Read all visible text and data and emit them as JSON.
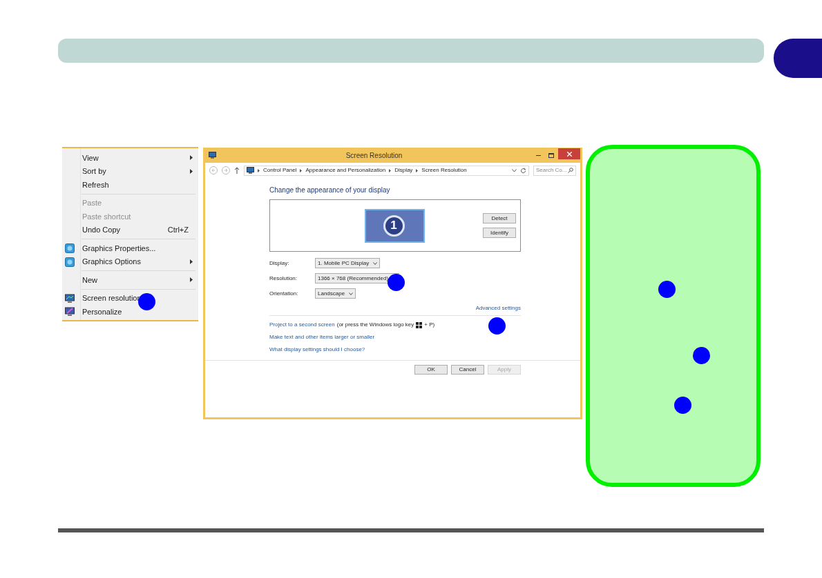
{
  "context_menu": {
    "items": [
      {
        "kind": "plain",
        "label": "View",
        "disabled": false,
        "submenu": true
      },
      {
        "kind": "plain",
        "label": "Sort by",
        "disabled": false,
        "submenu": true
      },
      {
        "kind": "plain",
        "label": "Refresh",
        "disabled": false,
        "submenu": false
      },
      {
        "kind": "separator"
      },
      {
        "kind": "plain",
        "label": "Paste",
        "disabled": true,
        "submenu": false
      },
      {
        "kind": "plain",
        "label": "Paste shortcut",
        "disabled": true,
        "submenu": false
      },
      {
        "kind": "plain",
        "label": "Undo Copy",
        "shortcut": "Ctrl+Z",
        "disabled": false,
        "submenu": false
      },
      {
        "kind": "separator"
      },
      {
        "kind": "graphics",
        "label": "Graphics Properties...",
        "disabled": false,
        "submenu": false
      },
      {
        "kind": "graphics",
        "label": "Graphics Options",
        "disabled": false,
        "submenu": true
      },
      {
        "kind": "separator"
      },
      {
        "kind": "plain",
        "label": "New",
        "disabled": false,
        "submenu": true
      },
      {
        "kind": "separator"
      },
      {
        "kind": "display",
        "label": "Screen resolution",
        "disabled": false,
        "submenu": false
      },
      {
        "kind": "personalize",
        "label": "Personalize",
        "disabled": false,
        "submenu": false
      }
    ]
  },
  "window": {
    "title": "Screen Resolution",
    "breadcrumbs": [
      "Control Panel",
      "Appearance and Personalization",
      "Display",
      "Screen Resolution"
    ],
    "search": {
      "placeholder": "Search Co..."
    },
    "heading": "Change the appearance of your display",
    "monitor_number": "1",
    "monitor_buttons": [
      "Detect",
      "Identify"
    ],
    "fields": [
      {
        "label": "Display:",
        "value": "1. Mobile PC Display"
      },
      {
        "label": "Resolution:",
        "value": "1366 × 768 (Recommended)"
      },
      {
        "label": "Orientation:",
        "value": "Landscape"
      }
    ],
    "advanced_link": "Advanced settings",
    "project": {
      "link": "Project to a second screen",
      "note_before": "(or press the Windows logo key",
      "note_after": "+ P)"
    },
    "links": [
      "Make text and other items larger or smaller",
      "What display settings should I choose?"
    ],
    "buttons": [
      {
        "label": "OK",
        "disabled": false
      },
      {
        "label": "Cancel",
        "disabled": false
      },
      {
        "label": "Apply",
        "disabled": true
      }
    ]
  }
}
